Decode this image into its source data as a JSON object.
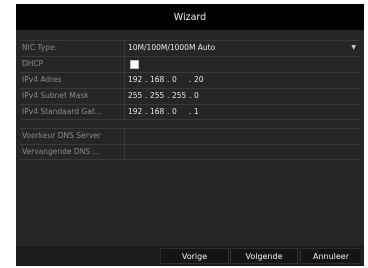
{
  "window": {
    "title": "Wizard"
  },
  "network": {
    "nic_type": {
      "label": "NIC Type:",
      "value": "10M/100M/1000M Auto"
    },
    "dhcp": {
      "label": "DHCP",
      "checked": false
    },
    "ipv4_address": {
      "label": "IPv4 Adres",
      "octets": [
        "192",
        "168",
        "0",
        "20"
      ]
    },
    "subnet_mask": {
      "label": "IPv4 Subnet Mask",
      "octets": [
        "255",
        "255",
        "255",
        "0"
      ]
    },
    "gateway": {
      "label": "IPv4 Standaard Gat...",
      "octets": [
        "192",
        "168",
        "0",
        "1"
      ]
    },
    "dns_preferred": {
      "label": "Voorkeur DNS Server",
      "value": ""
    },
    "dns_alternate": {
      "label": "Vervangende DNS ...",
      "value": ""
    }
  },
  "buttons": {
    "previous": "Vorige",
    "next": "Volgende",
    "cancel": "Annuleer"
  },
  "icons": {
    "dropdown": "chevron-down-icon"
  },
  "colors": {
    "background": "#262626",
    "titlebar": "#000000",
    "label": "#8a8a8a",
    "value": "#e6e6e6"
  }
}
